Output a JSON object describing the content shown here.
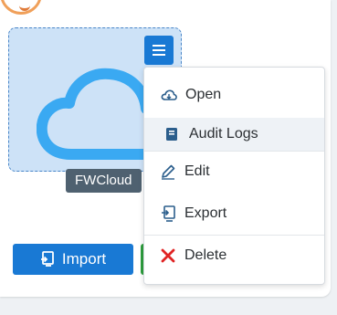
{
  "card": {
    "label": "FWCloud"
  },
  "actions": {
    "import_label": "Import"
  },
  "menu": {
    "items": [
      {
        "label": "Open",
        "icon": "cloud-icon"
      },
      {
        "label": "Audit Logs",
        "icon": "book-icon"
      },
      {
        "label": "Edit",
        "icon": "pencil-icon"
      },
      {
        "label": "Export",
        "icon": "export-icon"
      },
      {
        "label": "Delete",
        "icon": "close-icon"
      }
    ]
  },
  "colors": {
    "accent": "#1979d4",
    "card_bg": "#cde2f7",
    "cloud": "#3aa9f2",
    "label_bg": "#4f6170",
    "delete": "#e02424"
  }
}
